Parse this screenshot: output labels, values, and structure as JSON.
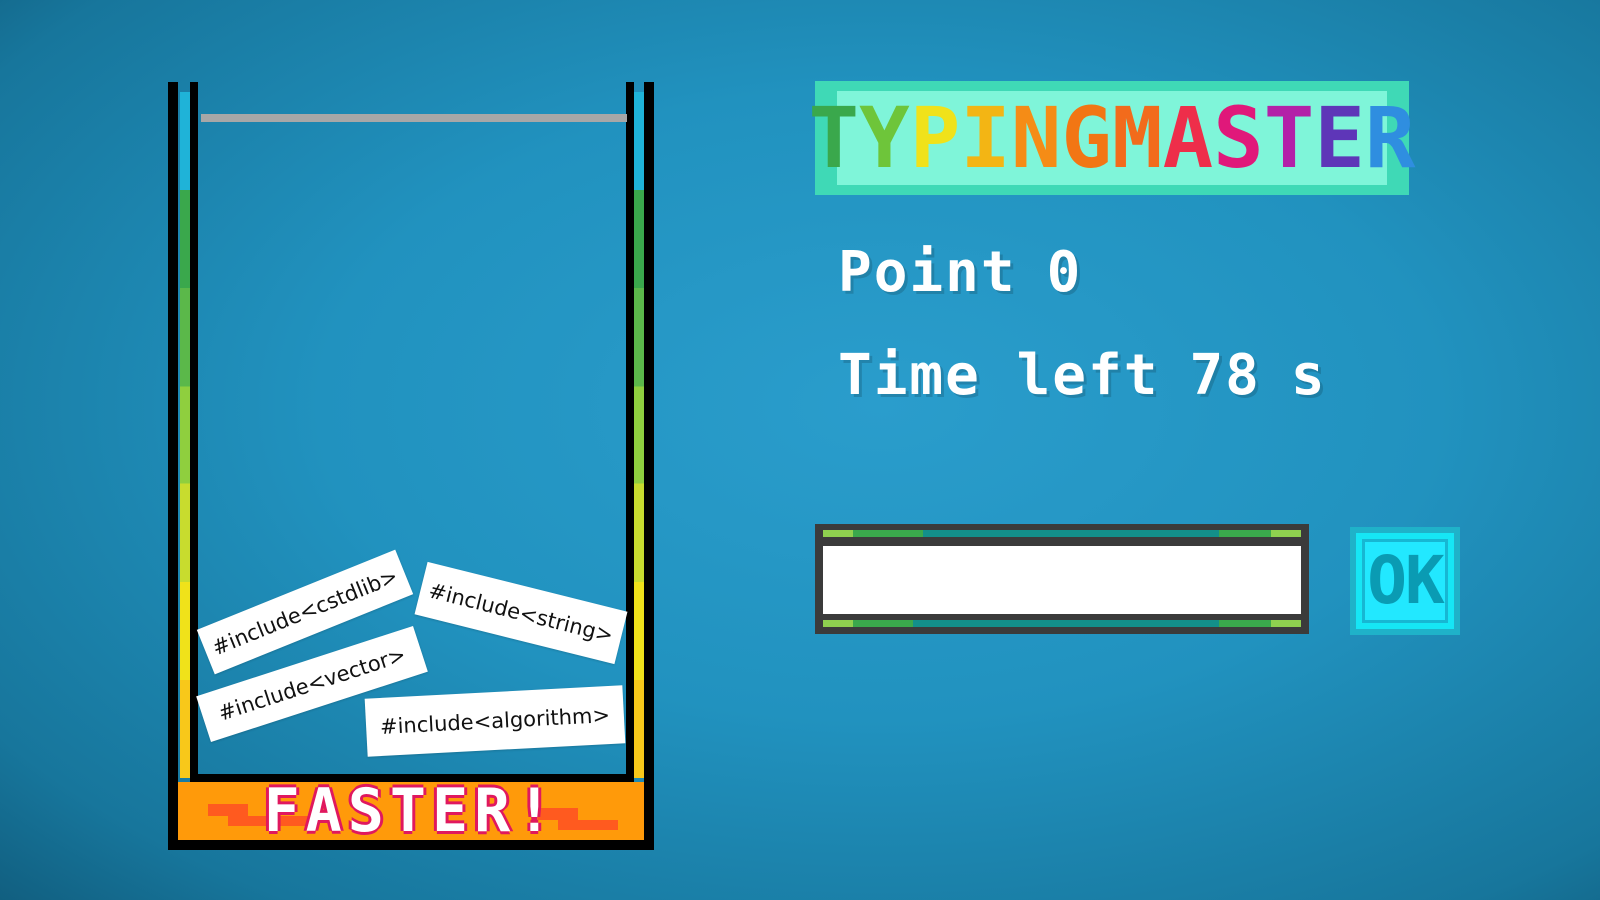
{
  "game": {
    "title_letters": [
      {
        "char": "T",
        "color": "#3aa84c"
      },
      {
        "char": "Y",
        "color": "#6ec53a"
      },
      {
        "char": "P",
        "color": "#f0e21a"
      },
      {
        "char": "I",
        "color": "#f3b514"
      },
      {
        "char": "N",
        "color": "#f58c16"
      },
      {
        "char": "G",
        "color": "#f27614"
      },
      {
        "char": " ",
        "color": "#000000"
      },
      {
        "char": "M",
        "color": "#f26b1c"
      },
      {
        "char": "A",
        "color": "#ee2e4a"
      },
      {
        "char": "S",
        "color": "#e0187a"
      },
      {
        "char": "T",
        "color": "#b321a8"
      },
      {
        "char": "E",
        "color": "#5e36b8"
      },
      {
        "char": "R",
        "color": "#2f8ee0"
      }
    ],
    "stats": {
      "points_label": "Point",
      "points_value": "0",
      "time_label": "Time left",
      "time_value": "78",
      "time_unit": "s"
    },
    "jar": {
      "warning_text": "FASTER!",
      "cards": [
        "#include<cstdlib>",
        "#include<string>",
        "#include<vector>",
        "#include<algorithm>"
      ]
    },
    "input": {
      "value": "",
      "placeholder": ""
    },
    "ok_button_label": "OK"
  },
  "colors": {
    "background": "#2192bf",
    "title_frame": "#3fd9b6",
    "title_fill": "#7ff5d9",
    "ok_button": "#22e8ff",
    "lava": "#ff9a0a",
    "warning_outline": "#e0185e"
  }
}
